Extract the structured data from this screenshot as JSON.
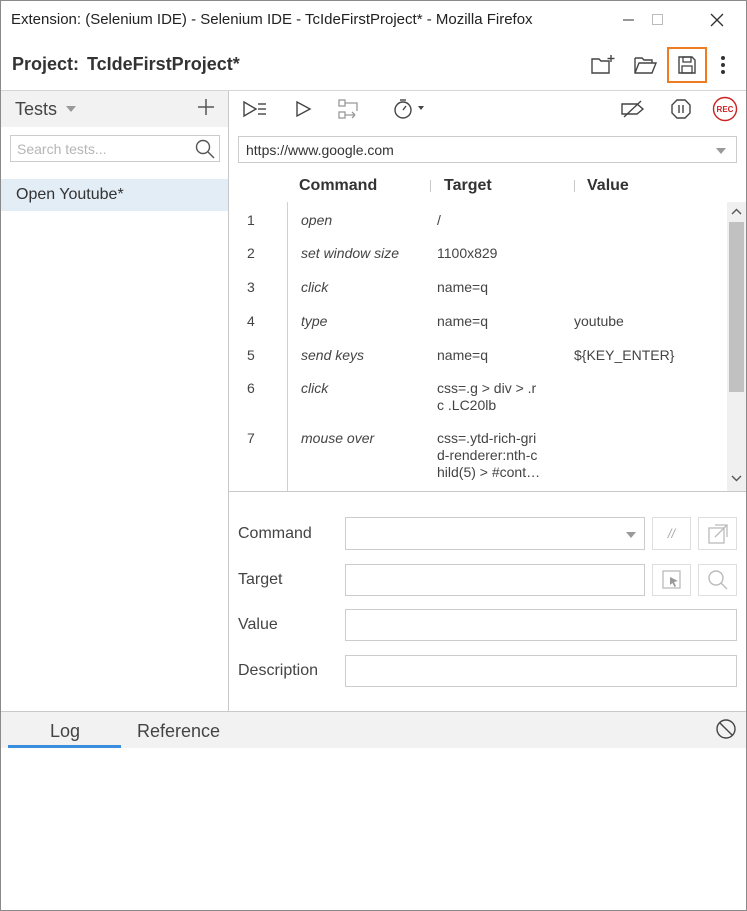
{
  "window": {
    "title": "Extension: (Selenium IDE) - Selenium IDE - TcIdeFirstProject* - Mozilla Firefox",
    "controls": [
      "minimize-icon",
      "maximize-icon",
      "close-icon"
    ]
  },
  "project": {
    "label": "Project:",
    "name": "TcIdeFirstProject*",
    "actions": [
      "new-project-icon",
      "open-project-icon",
      "save-project-icon",
      "more-options-icon"
    ],
    "highlight_color": "#ee7c22"
  },
  "tests": {
    "header": "Tests",
    "search_placeholder": "Search tests...",
    "items": [
      {
        "label": "Open Youtube*",
        "selected": true
      }
    ]
  },
  "toolbar": {
    "icons": [
      "run-all-tests-icon",
      "run-current-test-icon",
      "run-from-here-icon",
      "test-speed-icon",
      "disable-breakpoints-icon",
      "pause-on-exceptions-icon",
      "record-icon"
    ],
    "record_label": "REC",
    "record_color": "#cc2222"
  },
  "url": {
    "value": "https://www.google.com"
  },
  "table": {
    "headers": {
      "command": "Command",
      "target": "Target",
      "value": "Value"
    },
    "rows": [
      {
        "num": "1",
        "command": "open",
        "target": "/",
        "value": ""
      },
      {
        "num": "2",
        "command": "set window size",
        "target": "1100x829",
        "value": ""
      },
      {
        "num": "3",
        "command": "click",
        "target": "name=q",
        "value": ""
      },
      {
        "num": "4",
        "command": "type",
        "target": "name=q",
        "value": "youtube"
      },
      {
        "num": "5",
        "command": "send keys",
        "target": "name=q",
        "value": "${KEY_ENTER}"
      },
      {
        "num": "6",
        "command": "click",
        "target": "css=.g > div > .r\nc .LC20lb",
        "value": ""
      },
      {
        "num": "7",
        "command": "mouse over",
        "target": "css=.ytd-rich-gri\nd-renderer:nth-c\nhild(5) > #cont…",
        "value": ""
      }
    ]
  },
  "editor": {
    "command_label": "Command",
    "target_label": "Target",
    "value_label": "Value",
    "description_label": "Description",
    "comment_glyph": "//"
  },
  "bottom": {
    "tabs": [
      {
        "label": "Log",
        "active": true
      },
      {
        "label": "Reference",
        "active": false
      }
    ],
    "accent_color": "#3b8ddd"
  }
}
